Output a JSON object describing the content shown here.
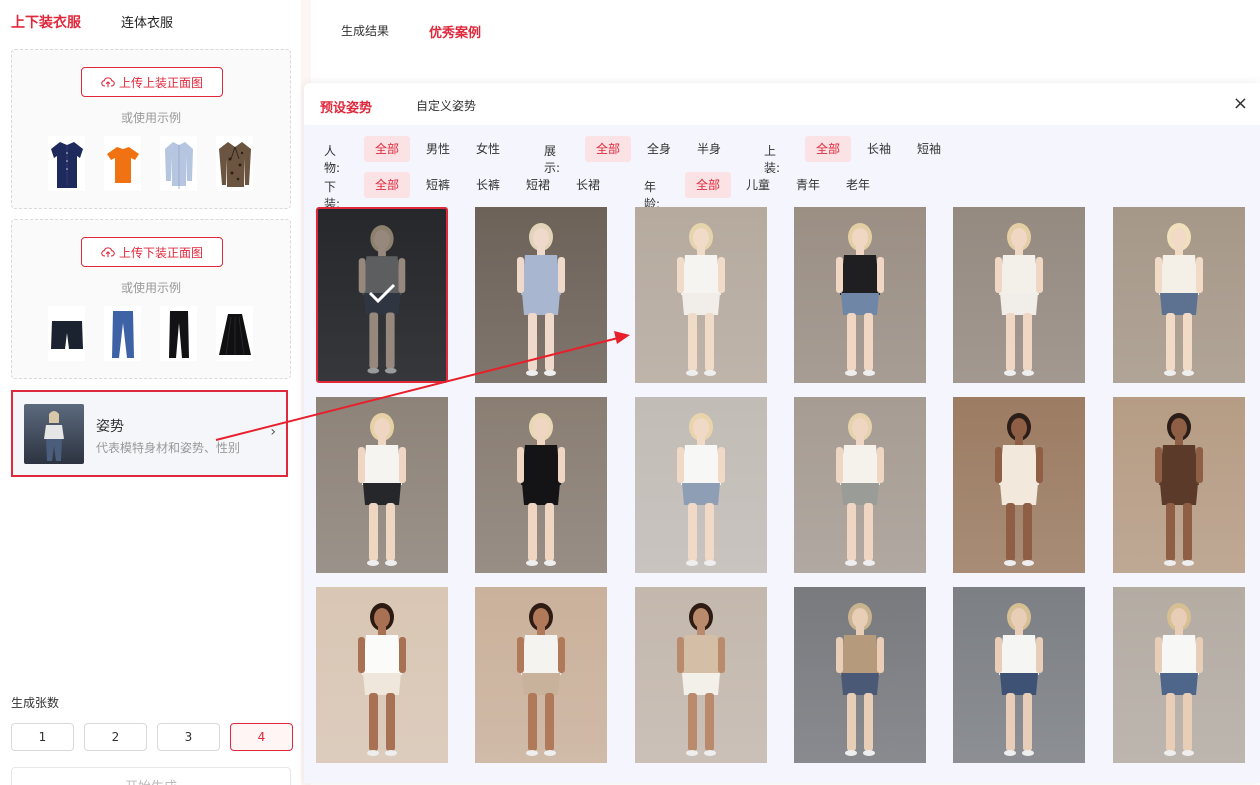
{
  "left": {
    "category_tabs": [
      "上下装衣服",
      "连体衣服"
    ],
    "top_upload": {
      "button": "上传上装正面图",
      "or_text": "或使用示例"
    },
    "bottom_upload": {
      "button": "上传下装正面图",
      "or_text": "或使用示例"
    },
    "top_samples": [
      "navy-shirt",
      "orange-tshirt",
      "light-blue-shirt",
      "leopard-blazer"
    ],
    "bottom_samples": [
      "black-shorts",
      "blue-jeans",
      "black-pants",
      "black-skirt"
    ],
    "pose": {
      "title": "姿势",
      "subtitle": "代表模特身材和姿势、性别"
    },
    "count": {
      "label": "生成张数",
      "options": [
        "1",
        "2",
        "3",
        "4"
      ],
      "selected": "4"
    },
    "generate": "开始生成"
  },
  "right": {
    "tabs": [
      "生成结果",
      "优秀案例"
    ],
    "active_tab": "优秀案例"
  },
  "modal": {
    "tabs": [
      "预设姿势",
      "自定义姿势"
    ],
    "active_tab": "预设姿势",
    "close": "×",
    "filters": {
      "person": {
        "label": "人物:",
        "options": [
          "全部",
          "男性",
          "女性"
        ]
      },
      "display": {
        "label": "展示:",
        "options": [
          "全部",
          "全身",
          "半身"
        ]
      },
      "top": {
        "label": "上装:",
        "options": [
          "全部",
          "长袖",
          "短袖"
        ]
      },
      "bottom": {
        "label": "下装:",
        "options": [
          "全部",
          "短裤",
          "长裤",
          "短裙",
          "长裙"
        ]
      },
      "age": {
        "label": "年龄:",
        "options": [
          "全部",
          "儿童",
          "青年",
          "老年"
        ]
      }
    },
    "poses": [
      {
        "bg": "#3a3d42",
        "hair": "#d8c7a8",
        "skin": "#e9d2c2",
        "top": "#8f9194",
        "bottom": "#4a5364",
        "selected": true
      },
      {
        "bg": "#6d6258",
        "hair": "#e2d4b8",
        "skin": "#eed9cb",
        "top": "#a9b6cf",
        "bottom": "#a9b6cf",
        "selected": false
      },
      {
        "bg": "#b6aa9e",
        "hair": "#e6d4ad",
        "skin": "#f0dbc9",
        "top": "#f6f4f0",
        "bottom": "#f1eee9",
        "selected": false
      },
      {
        "bg": "#9b8f84",
        "hair": "#e4cfa4",
        "skin": "#efd7c4",
        "top": "#1f1f22",
        "bottom": "#6f86a6",
        "selected": false
      },
      {
        "bg": "#958a80",
        "hair": "#e4cfa4",
        "skin": "#efd7c4",
        "top": "#f3f0ea",
        "bottom": "#f1ede8",
        "selected": false
      },
      {
        "bg": "#a69888",
        "hair": "#f0e0bc",
        "skin": "#f1dac6",
        "top": "#f4efe7",
        "bottom": "#5d7190",
        "selected": false
      },
      {
        "bg": "#8d8379",
        "hair": "#e6d1a6",
        "skin": "#efd6c2",
        "top": "#f5f4f1",
        "bottom": "#26272b",
        "selected": false
      },
      {
        "bg": "#8a7e73",
        "hair": "#e9d8b4",
        "skin": "#efd6c2",
        "top": "#141416",
        "bottom": "#141416",
        "selected": false
      },
      {
        "bg": "#c2bcb6",
        "hair": "#e8d5ac",
        "skin": "#f0d9c6",
        "top": "#f7f7f6",
        "bottom": "#8e9eb4",
        "selected": false
      },
      {
        "bg": "#a69c93",
        "hair": "#e6d3ad",
        "skin": "#efd6c2",
        "top": "#f5f2ec",
        "bottom": "#9a9c97",
        "selected": false
      },
      {
        "bg": "#9c7c62",
        "hair": "#2b1d17",
        "skin": "#8e5e45",
        "top": "#f2e8dc",
        "bottom": "#f2e8dc",
        "selected": false
      },
      {
        "bg": "#b69c84",
        "hair": "#2b1d17",
        "skin": "#8e5e45",
        "top": "#5b3a2a",
        "bottom": "#5b3a2a",
        "selected": false
      },
      {
        "bg": "#d9c6b4",
        "hair": "#2a1a12",
        "skin": "#a87154",
        "top": "#fbfbfa",
        "bottom": "#efe6dc",
        "selected": false
      },
      {
        "bg": "#cab19b",
        "hair": "#2e1c14",
        "skin": "#b07a5a",
        "top": "#f5f3ef",
        "bottom": "#c9b29b",
        "selected": false
      },
      {
        "bg": "#c4b8ad",
        "hair": "#2e1c14",
        "skin": "#b98a6c",
        "top": "#d4bfa6",
        "bottom": "#f3efe9",
        "selected": false
      },
      {
        "bg": "#787a7e",
        "hair": "#c9b48f",
        "skin": "#e8cdb7",
        "top": "#b59a7c",
        "bottom": "#4a5a76",
        "selected": false
      },
      {
        "bg": "#7c7f84",
        "hair": "#d5bf93",
        "skin": "#e8cdb7",
        "top": "#f5f5f4",
        "bottom": "#3d5275",
        "selected": false
      },
      {
        "bg": "#b4aca3",
        "hair": "#d5bf93",
        "skin": "#e8cdb7",
        "top": "#f7f7f6",
        "bottom": "#4d6689",
        "selected": false
      }
    ]
  }
}
